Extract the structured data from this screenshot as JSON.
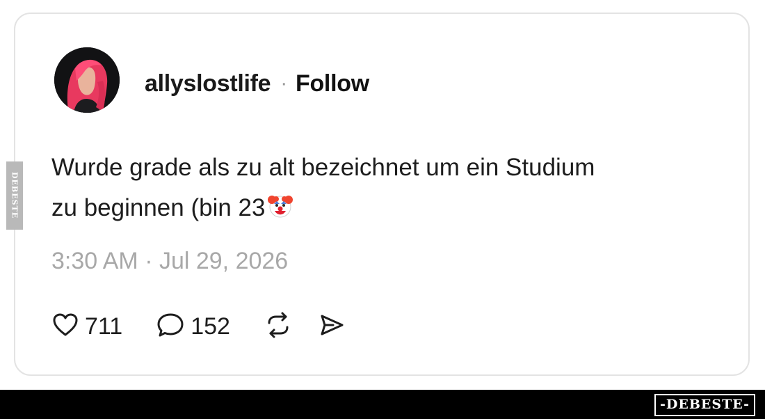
{
  "post": {
    "username": "allyslostlife",
    "separator": "·",
    "follow_label": "Follow",
    "text": "Wurde grade als zu alt bezeichnet um ein Studium\nzu beginnen (bin 23",
    "emoji_icon": "clown-face-icon",
    "timestamp": "3:30 AM · Jul 29, 2026",
    "likes": "711",
    "replies": "152"
  },
  "icons": {
    "like": "heart-icon",
    "reply": "comment-bubble-icon",
    "repost": "repost-icon",
    "share": "send-icon"
  },
  "watermark": {
    "side_text": "DEBESTE",
    "brand": "-DEBESTE-"
  },
  "colors": {
    "card_border": "#e3e3e3",
    "timestamp": "#a8a8a8",
    "bar": "#000000",
    "avatar_hair": "#ff3d6e"
  }
}
